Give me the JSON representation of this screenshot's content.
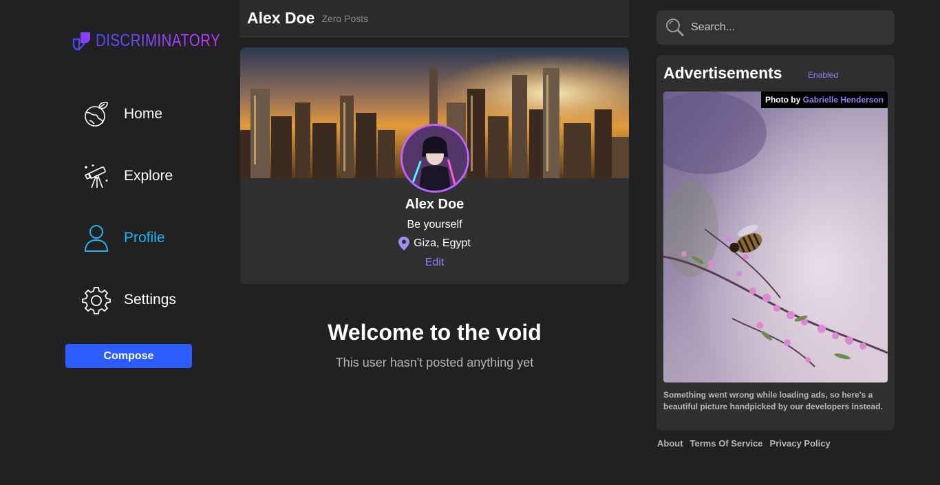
{
  "app": {
    "brand": "DISCRIMINATORY"
  },
  "nav": [
    {
      "label": "Home",
      "icon": "globe-leaf-icon",
      "active": false
    },
    {
      "label": "Explore",
      "icon": "telescope-icon",
      "active": false
    },
    {
      "label": "Profile",
      "icon": "user-icon",
      "active": true
    },
    {
      "label": "Settings",
      "icon": "gear-icon",
      "active": false
    }
  ],
  "compose_label": "Compose",
  "header": {
    "name": "Alex Doe",
    "post_count": "Zero Posts"
  },
  "profile": {
    "name": "Alex Doe",
    "bio": "Be yourself",
    "location": "Giza, Egypt",
    "edit_label": "Edit"
  },
  "empty_state": {
    "title": "Welcome to the void",
    "subtitle": "This user hasn't posted anything yet"
  },
  "search": {
    "placeholder": "Search..."
  },
  "ads": {
    "title": "Advertisements",
    "status": "Enabled",
    "credit_prefix": "Photo by",
    "credit_author": "Gabrielle Henderson",
    "message": "Something went wrong while loading ads, so here's a beautiful picture handpicked by our developers instead."
  },
  "footer": {
    "about": "About",
    "tos": "Terms Of Service",
    "privacy": "Privacy Policy"
  },
  "colors": {
    "accent": "#1db5f3",
    "purple": "#9b7cf8",
    "compose": "#2d5dff",
    "background": "#212121"
  }
}
